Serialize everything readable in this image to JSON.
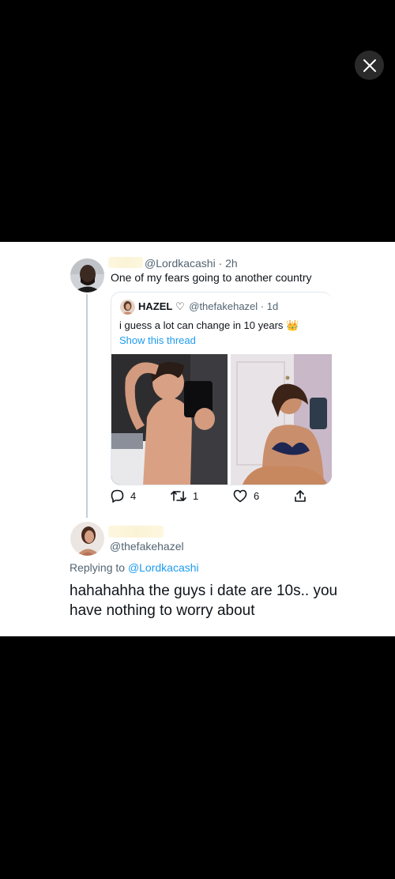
{
  "viewer": {
    "close_icon": "close-icon"
  },
  "tweet": {
    "handle": "@Lordkacashi",
    "time": "· 2h",
    "text": "One of my fears going to another country"
  },
  "quoted": {
    "name": "HAZEL",
    "heart_symbol": "♡",
    "handle": "@thefakehazel",
    "time": "· 1d",
    "text": "i guess a lot can change in 10 years",
    "emoji": "👑",
    "show_thread": "Show this thread"
  },
  "actions": {
    "replies": "4",
    "retweets": "1",
    "likes": "6"
  },
  "reply": {
    "handle": "@thefakehazel",
    "replying_prefix": "Replying to",
    "replying_to": "@Lordkacashi",
    "text_line1": "hahahahha the guys i date are 10s.. you",
    "text_line2": "have nothing to worry about"
  },
  "colors": {
    "background": "#000000",
    "card": "#ffffff",
    "link": "#1d9bf0",
    "muted": "#536471"
  }
}
